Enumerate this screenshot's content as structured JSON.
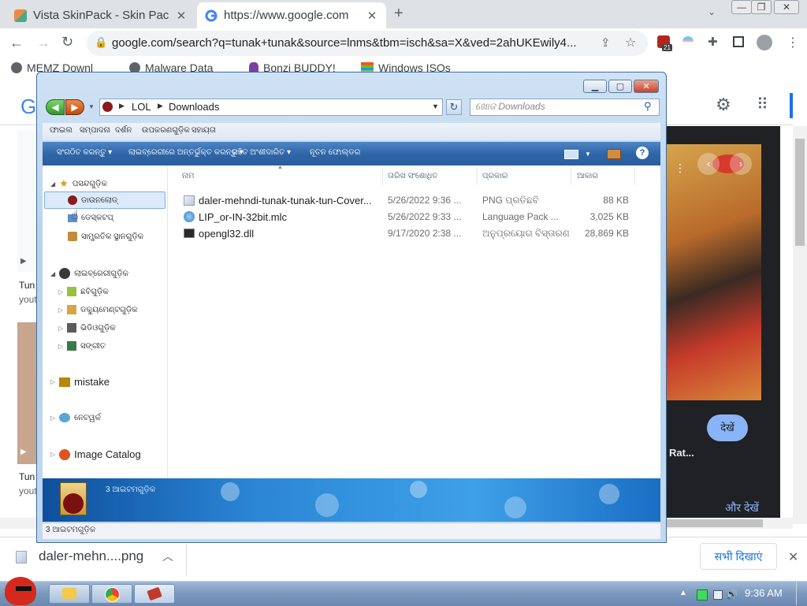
{
  "chrome": {
    "tabs": [
      {
        "title": "Vista SkinPack - Skin Pac",
        "active": false
      },
      {
        "title": "https://www.google.com",
        "active": true
      }
    ],
    "url": "google.com/search?q=tunak+tunak&source=lnms&tbm=isch&sa=X&ved=2ahUKEwily4...",
    "extension_badge": "21",
    "bookmarks": [
      "MEMZ Downl",
      "Malware Data",
      "Bonzi BUDDY!",
      "Windows ISOs"
    ]
  },
  "google_page": {
    "left_texts": [
      "Tun",
      "yout",
      "Tun",
      "yout"
    ],
    "view_button": "देखें",
    "result_label": "Rat...",
    "more_link": "और देखें"
  },
  "download_bar": {
    "file": "daler-mehn....png",
    "show_all": "सभी दिखाएं"
  },
  "taskbar": {
    "clock": "9:36 AM"
  },
  "explorer": {
    "breadcrumb": [
      "LOL",
      "Downloads"
    ],
    "search_placeholder": "ଖୋଜ Downloads",
    "menu": [
      "ଫାଇଲ",
      "ସମ୍ପାଦନା",
      "ଦର୍ଶନ",
      "ଉପକରଣଗୁଡ଼ିକ",
      "ସହାୟତା"
    ],
    "commands": [
      "ସଂଗଠିତ କରନ୍ତୁ",
      "ଲାଇବ୍ରେରୀରେ ଅନ୍ତର୍ଭୁକ୍ତ କରନ୍ତୁ",
      "ସହିତ ଅଂଶୀଦାରିତ",
      "ନୂତନ ଫୋଲ୍ଡର"
    ],
    "nav": {
      "favorites_header": "ପସନ୍ଦଗୁଡ଼ିକ",
      "favorites": [
        "ଡାଉନଲୋଡ୍",
        "ଡେସ୍କଟପ୍",
        "ସାମ୍ପ୍ରତିକ ସ୍ଥାନଗୁଡ଼ିକ"
      ],
      "libraries_header": "ଲାଇବ୍ରେରୀଗୁଡ଼ିକ",
      "libraries": [
        "ଛବିଗୁଡ଼ିକ",
        "ଡକ୍ୟୁମେଣ୍ଟଗୁଡ଼ିକ",
        "ଭିଡିଓଗୁଡ଼ିକ",
        "ସଙ୍ଗୀତ"
      ],
      "mistake": "mistake",
      "network": "ନେଟୱର୍କ",
      "image_catalog": "Image Catalog"
    },
    "columns": [
      "ନାମ",
      "ତାରିଖ ସଂଶୋଧିତ",
      "ପ୍ରକାର",
      "ଆକାର"
    ],
    "files": [
      {
        "name": "daler-mehndi-tunak-tunak-tun-Cover...",
        "date": "5/26/2022 9:36 ...",
        "type": "PNG ପ୍ରତିଛବି",
        "size": "88 KB"
      },
      {
        "name": "LIP_or-IN-32bit.mlc",
        "date": "5/26/2022 9:33 ...",
        "type": "Language Pack ...",
        "size": "3,025 KB"
      },
      {
        "name": "opengl32.dll",
        "date": "9/17/2020 2:38 ...",
        "type": "ଅନୁପ୍ରୟୋଗ ବିସ୍ତାରଣ",
        "size": "28,869 KB"
      }
    ],
    "details_text": "3 ଆଇଟମଗୁଡ଼ିକ",
    "status_text": "3 ଆଇଟମଗୁଡ଼ିକ"
  }
}
